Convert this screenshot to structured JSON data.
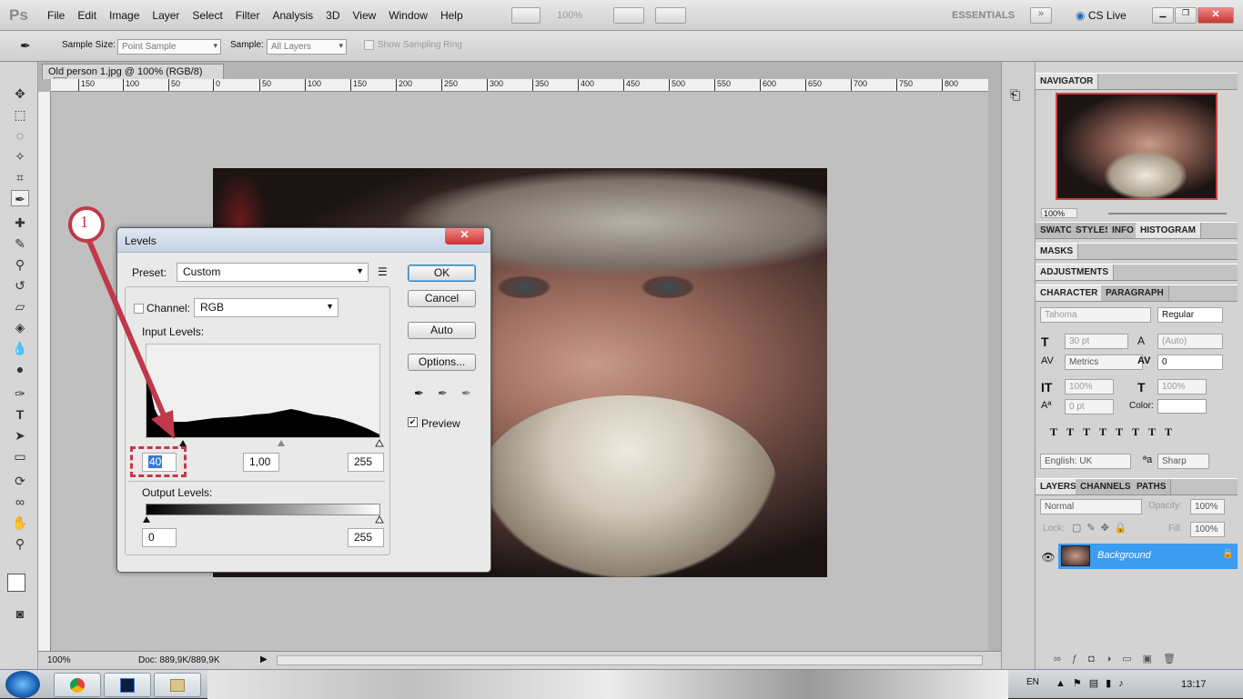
{
  "menubar": {
    "logo": "Ps",
    "items": [
      "File",
      "Edit",
      "Image",
      "Layer",
      "Select",
      "Filter",
      "Analysis",
      "3D",
      "View",
      "Window",
      "Help"
    ],
    "zoom": "100%",
    "workspace": "ESSENTIALS",
    "cslive": "CS Live"
  },
  "options": {
    "sample_size_label": "Sample Size:",
    "sample_size_value": "Point Sample",
    "sample_label": "Sample:",
    "sample_value": "All Layers",
    "ring_label": "Show Sampling Ring"
  },
  "document": {
    "tab_title": "Old person 1.jpg @ 100% (RGB/8)",
    "ruler_ticks": [
      "150",
      "100",
      "50",
      "0",
      "50",
      "100",
      "150",
      "200",
      "250",
      "300",
      "350",
      "400",
      "450",
      "500",
      "550",
      "600",
      "650",
      "700",
      "750",
      "800"
    ],
    "status_zoom": "100%",
    "status_doc": "Doc: 889,9K/889,9K"
  },
  "levels": {
    "title": "Levels",
    "preset_label": "Preset:",
    "preset_value": "Custom",
    "channel_label": "Channel:",
    "channel_value": "RGB",
    "input_label": "Input Levels:",
    "input_black": "40",
    "input_gamma": "1,00",
    "input_white": "255",
    "output_label": "Output Levels:",
    "output_black": "0",
    "output_white": "255",
    "ok": "OK",
    "cancel": "Cancel",
    "auto": "Auto",
    "options": "Options...",
    "preview": "Preview"
  },
  "annotation": {
    "number": "1",
    "color": "#c0394a"
  },
  "panels": {
    "navigator": "NAVIGATOR",
    "nav_zoom": "100%",
    "tabs1": [
      "SWATC",
      "STYLES",
      "INFO",
      "HISTOGRAM"
    ],
    "masks": "MASKS",
    "adjustments": "ADJUSTMENTS",
    "tabs2": [
      "CHARACTER",
      "PARAGRAPH"
    ],
    "char_font": "Tahoma",
    "char_style": "Regular",
    "char_size": "30 pt",
    "char_leading": "(Auto)",
    "char_kerning": "Metrics",
    "char_tracking": "0",
    "char_vscale": "100%",
    "char_hscale": "100%",
    "char_baseline": "0 pt",
    "char_color_label": "Color:",
    "char_lang": "English: UK",
    "char_aa": "Sharp",
    "tabs3": [
      "LAYERS",
      "CHANNELS",
      "PATHS"
    ],
    "blend": "Normal",
    "opacity_label": "Opacity:",
    "opacity": "100%",
    "lock_label": "Lock:",
    "fill_label": "Fill:",
    "fill": "100%",
    "layer_name": "Background"
  },
  "taskbar": {
    "lang": "EN",
    "time": "13:17"
  }
}
